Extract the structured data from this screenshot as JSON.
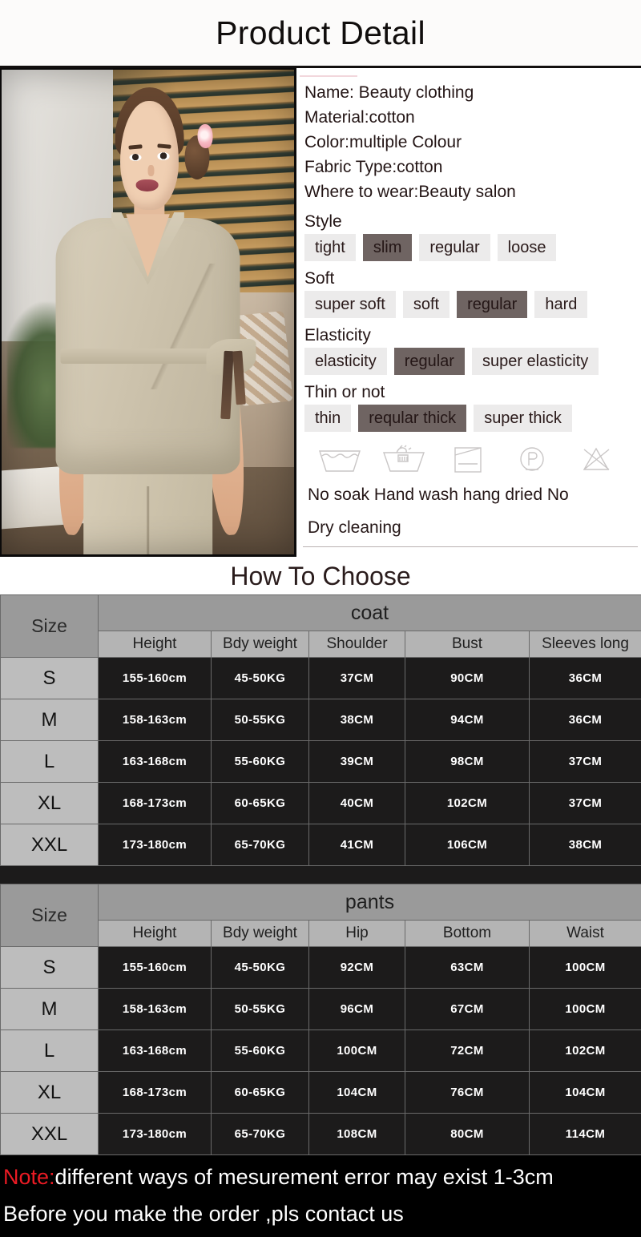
{
  "header": {
    "title": "Product Detail"
  },
  "product": {
    "specs": [
      "Name:  Beauty clothing",
      "Material:cotton",
      "Color:multiple Colour",
      "Fabric Type:cotton",
      "Where to wear:Beauty salon"
    ],
    "attributes": [
      {
        "label": "Style",
        "options": [
          "tight",
          "slim",
          "regular",
          "loose"
        ],
        "selected": "slim"
      },
      {
        "label": "Soft",
        "options": [
          "super soft",
          "soft",
          "regular",
          "hard"
        ],
        "selected": "regular"
      },
      {
        "label": "Elasticity",
        "options": [
          "elasticity",
          "regular",
          "super elasticity"
        ],
        "selected": "regular"
      },
      {
        "label": "Thin or not",
        "options": [
          "thin",
          "reqular thick",
          "super thick"
        ],
        "selected": "reqular thick"
      }
    ],
    "care": {
      "icons": [
        "wash-tub-icon",
        "hand-wash-icon",
        "hang-dry-icon",
        "dry-clean-p-icon",
        "no-bleach-icon"
      ],
      "text_line1": "No soak  Hand wash hang dried  No",
      "text_line2": "Dry cleaning"
    }
  },
  "sizing": {
    "title": "How To Choose",
    "size_label": "Size",
    "tables": [
      {
        "group": "coat",
        "columns": [
          "Height",
          "Bdy weight",
          "Shoulder",
          "Bust",
          "Sleeves long"
        ],
        "rows": [
          {
            "size": "S",
            "values": [
              "155-160cm",
              "45-50KG",
              "37CM",
              "90CM",
              "36CM"
            ]
          },
          {
            "size": "M",
            "values": [
              "158-163cm",
              "50-55KG",
              "38CM",
              "94CM",
              "36CM"
            ]
          },
          {
            "size": "L",
            "values": [
              "163-168cm",
              "55-60KG",
              "39CM",
              "98CM",
              "37CM"
            ]
          },
          {
            "size": "XL",
            "values": [
              "168-173cm",
              "60-65KG",
              "40CM",
              "102CM",
              "37CM"
            ]
          },
          {
            "size": "XXL",
            "values": [
              "173-180cm",
              "65-70KG",
              "41CM",
              "106CM",
              "38CM"
            ]
          }
        ]
      },
      {
        "group": "pants",
        "columns": [
          "Height",
          "Bdy weight",
          "Hip",
          "Bottom",
          "Waist"
        ],
        "rows": [
          {
            "size": "S",
            "values": [
              "155-160cm",
              "45-50KG",
              "92CM",
              "63CM",
              "100CM"
            ]
          },
          {
            "size": "M",
            "values": [
              "158-163cm",
              "50-55KG",
              "96CM",
              "67CM",
              "100CM"
            ]
          },
          {
            "size": "L",
            "values": [
              "163-168cm",
              "55-60KG",
              "100CM",
              "72CM",
              "102CM"
            ]
          },
          {
            "size": "XL",
            "values": [
              "168-173cm",
              "60-65KG",
              "104CM",
              "76CM",
              "104CM"
            ]
          },
          {
            "size": "XXL",
            "values": [
              "173-180cm",
              "65-70KG",
              "108CM",
              "80CM",
              "114CM"
            ]
          }
        ]
      }
    ]
  },
  "note": {
    "keyword": "Note:",
    "line1_rest": "different ways of mesurement error may exist 1-3cm",
    "line2": "Before you make the order ,pls contact us"
  },
  "colors": {
    "selected_pill": "#6f6462",
    "pill_bg": "#ecebeb",
    "note_keyword": "#ec1b24",
    "table_value_bg": "#1c1b1b",
    "table_header_bg": "#9a9a9a"
  }
}
